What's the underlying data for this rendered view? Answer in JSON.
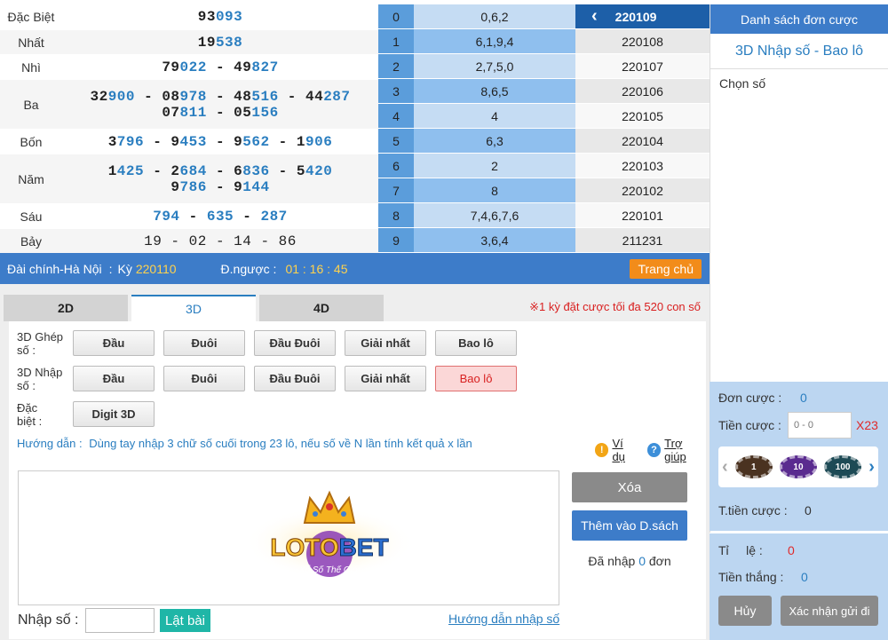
{
  "results": [
    {
      "prize": "Đặc Biệt",
      "lines": [
        [
          {
            "t": "93",
            "h": false
          },
          {
            "t": "093",
            "h": true
          }
        ]
      ],
      "h": 29
    },
    {
      "prize": "Nhất",
      "lines": [
        [
          {
            "t": "19",
            "h": false
          },
          {
            "t": "538",
            "h": true
          }
        ]
      ],
      "h": 28
    },
    {
      "prize": "Nhì",
      "lines": [
        [
          {
            "t": "79",
            "h": false
          },
          {
            "t": "022",
            "h": true
          },
          {
            "t": " - ",
            "h": false
          },
          {
            "t": "49",
            "h": false
          },
          {
            "t": "827",
            "h": true
          }
        ]
      ],
      "h": 28
    },
    {
      "prize": "Ba",
      "lines": [
        [
          {
            "t": "32",
            "h": false
          },
          {
            "t": "900",
            "h": true
          },
          {
            "t": " - ",
            "h": false
          },
          {
            "t": "08",
            "h": false
          },
          {
            "t": "978",
            "h": true
          },
          {
            "t": " - ",
            "h": false
          },
          {
            "t": "48",
            "h": false
          },
          {
            "t": "516",
            "h": true
          },
          {
            "t": " - ",
            "h": false
          },
          {
            "t": "44",
            "h": false
          },
          {
            "t": "287",
            "h": true
          }
        ],
        [
          {
            "t": "07",
            "h": false
          },
          {
            "t": "811",
            "h": true
          },
          {
            "t": " - ",
            "h": false
          },
          {
            "t": "05",
            "h": false
          },
          {
            "t": "156",
            "h": true
          }
        ]
      ],
      "h": 56
    },
    {
      "prize": "Bốn",
      "lines": [
        [
          {
            "t": "3",
            "h": false
          },
          {
            "t": "796",
            "h": true
          },
          {
            "t": " - ",
            "h": false
          },
          {
            "t": "9",
            "h": false
          },
          {
            "t": "453",
            "h": true
          },
          {
            "t": " - ",
            "h": false
          },
          {
            "t": "9",
            "h": false
          },
          {
            "t": "562",
            "h": true
          },
          {
            "t": " - ",
            "h": false
          },
          {
            "t": "1",
            "h": false
          },
          {
            "t": "906",
            "h": true
          }
        ]
      ],
      "h": 28
    },
    {
      "prize": "Năm",
      "lines": [
        [
          {
            "t": "1",
            "h": false
          },
          {
            "t": "425",
            "h": true
          },
          {
            "t": " - ",
            "h": false
          },
          {
            "t": "2",
            "h": false
          },
          {
            "t": "684",
            "h": true
          },
          {
            "t": " - ",
            "h": false
          },
          {
            "t": "6",
            "h": false
          },
          {
            "t": "836",
            "h": true
          },
          {
            "t": " - ",
            "h": false
          },
          {
            "t": "5",
            "h": false
          },
          {
            "t": "420",
            "h": true
          }
        ],
        [
          {
            "t": "9",
            "h": false
          },
          {
            "t": "786",
            "h": true
          },
          {
            "t": " - ",
            "h": false
          },
          {
            "t": "9",
            "h": false
          },
          {
            "t": "144",
            "h": true
          }
        ]
      ],
      "h": 56
    },
    {
      "prize": "Sáu",
      "lines": [
        [
          {
            "t": "794",
            "h": true
          },
          {
            "t": " - ",
            "h": false
          },
          {
            "t": "635",
            "h": true
          },
          {
            "t": " - ",
            "h": false
          },
          {
            "t": "287",
            "h": true
          }
        ]
      ],
      "h": 28
    },
    {
      "prize": "Bảy",
      "lines": [
        [
          {
            "t": "19 - 02 - 14 - 86",
            "h": false,
            "plain": true
          }
        ]
      ],
      "h": 28
    }
  ],
  "digits": [
    {
      "d": "0",
      "v": "0,6,2"
    },
    {
      "d": "1",
      "v": "6,1,9,4"
    },
    {
      "d": "2",
      "v": "2,7,5,0"
    },
    {
      "d": "3",
      "v": "8,6,5"
    },
    {
      "d": "4",
      "v": "4"
    },
    {
      "d": "5",
      "v": "6,3"
    },
    {
      "d": "6",
      "v": "2"
    },
    {
      "d": "7",
      "v": "8"
    },
    {
      "d": "8",
      "v": "7,4,6,7,6"
    },
    {
      "d": "9",
      "v": "3,6,4"
    }
  ],
  "periods": [
    "220109",
    "220108",
    "220107",
    "220106",
    "220105",
    "220104",
    "220103",
    "220102",
    "220101",
    "211231"
  ],
  "period_prev_icon": "chevron-left-icon",
  "info": {
    "station": "Đài chính-Hà Nội",
    "ky_label": "Kỳ",
    "ky": "220110",
    "countdown_label": "Đ.ngược :",
    "countdown": "01 : 16 : 45",
    "home": "Trang chủ"
  },
  "tabs": [
    "2D",
    "3D",
    "4D"
  ],
  "active_tab": "3D",
  "warning": "※1 kỳ đặt cược tối đa 520 con số",
  "rows": {
    "ghep_label": "3D Ghép số :",
    "nhap_label": "3D Nhập số :",
    "dacbiet_label": "Đặc biệt :",
    "options": [
      "Đầu",
      "Đuôi",
      "Đầu Đuôi",
      "Giải nhất",
      "Bao lô"
    ],
    "digit3d": "Digit 3D"
  },
  "guide_label": "Hướng dẫn :",
  "guide_text": "Dùng tay nhập 3 chữ số cuối trong 23 lô, nếu số về N lần tính kết quả x lần",
  "vidu": "Ví dụ",
  "trogiup": "Trợ giúp",
  "logo": {
    "brand_a": "LOTO",
    "brand_b": "BET",
    "tagline": "Xổ Số Thế Giới"
  },
  "btn_xoa": "Xóa",
  "btn_them": "Thêm vào D.sách",
  "da_nhap_pre": "Đã nhập",
  "da_nhap_count": "0",
  "da_nhap_post": "đơn",
  "nhapso_label": "Nhập số :",
  "latbai": "Lật bài",
  "huongdan_nhap": "Hướng dẫn nhập số",
  "right": {
    "header": "Danh sách đơn cược",
    "sub": "3D Nhập số - Bao lô",
    "chon_so": "Chọn số",
    "don_cuoc_label": "Đơn cược :",
    "don_cuoc": "0",
    "tien_cuoc_label": "Tiền cược :",
    "tien_placeholder": "0 - 0",
    "multiplier": "X23",
    "chips": [
      "1",
      "10",
      "100"
    ],
    "tong_label": "T.tiền cược :",
    "tong": "0",
    "ti_le_label": "Tỉ     lệ :",
    "ti_le": "0",
    "tien_thang_label": "Tiền thắng :",
    "tien_thang": "0",
    "huy": "Hủy",
    "xac_nhan": "Xác nhận gửi đi"
  }
}
